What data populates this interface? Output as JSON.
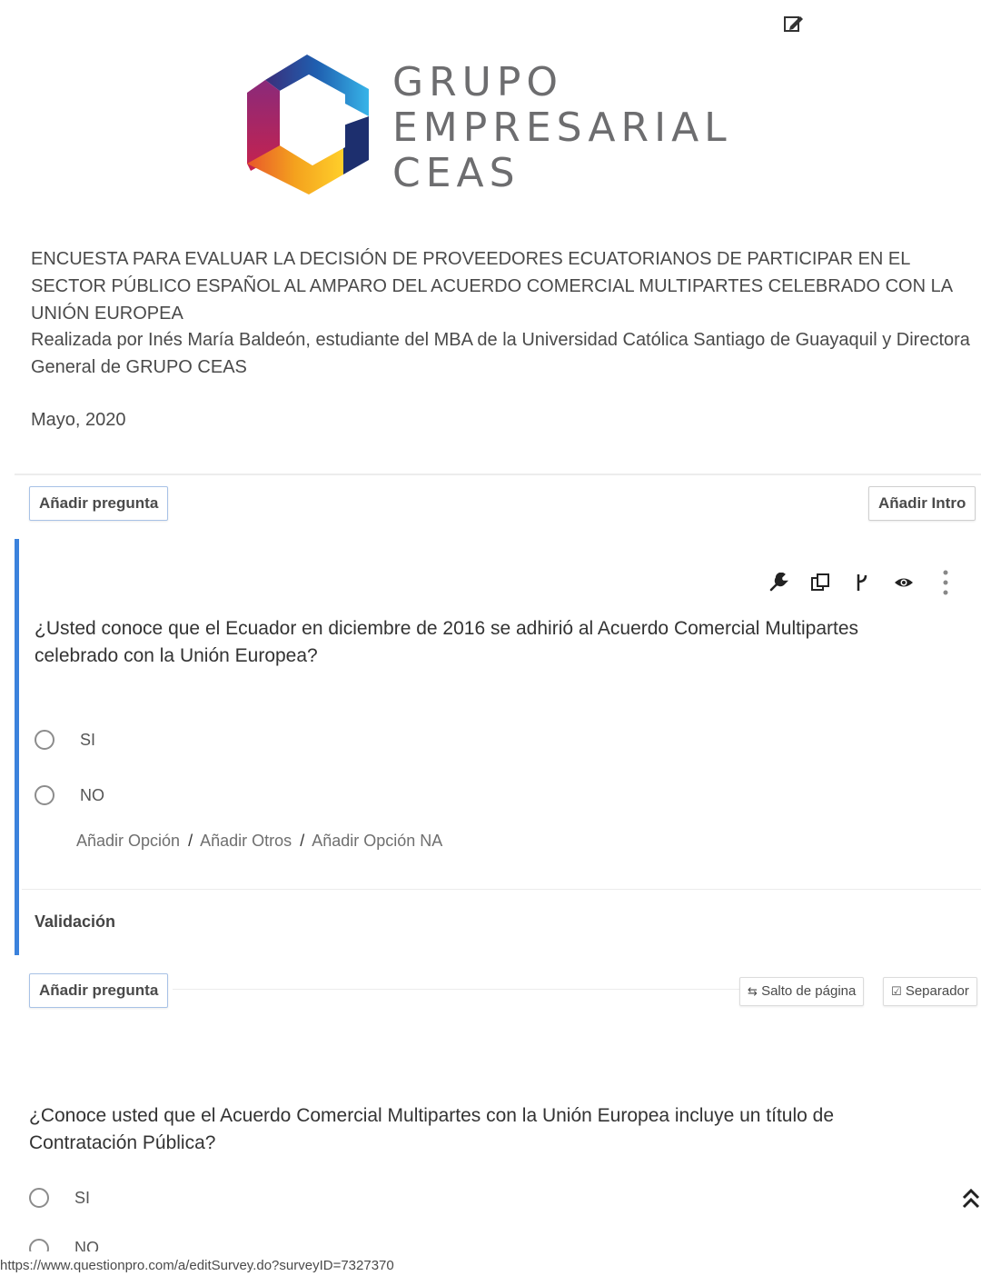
{
  "logo": {
    "line1": "GRUPO",
    "line2": "EMPRESARIAL",
    "line3": "CEAS"
  },
  "intro": {
    "title": "ENCUESTA PARA EVALUAR LA DECISIÓN DE PROVEEDORES ECUATORIANOS DE PARTICIPAR EN EL SECTOR PÚBLICO ESPAÑOL AL AMPARO DEL ACUERDO COMERCIAL MULTIPARTES CELEBRADO CON LA UNIÓN EUROPEA",
    "author": "Realizada por Inés María Baldeón, estudiante del MBA de la Universidad Católica Santiago de Guayaquil y Directora General de GRUPO CEAS",
    "date": "Mayo, 2020"
  },
  "toolbar_top": {
    "add_question": "Añadir pregunta",
    "add_intro": "Añadir Intro"
  },
  "question1": {
    "text": "¿Usted conoce que el Ecuador en diciembre de 2016 se adhirió al Acuerdo Comercial Multipartes celebrado con la Unión Europea?",
    "options": [
      "SI",
      "NO"
    ],
    "add_option": "Añadir Opción",
    "add_other": "Añadir Otros",
    "add_na": "Añadir Opción NA",
    "separator": "/",
    "validation": "Validación",
    "tools": [
      "wrench-icon",
      "copy-icon",
      "branch-icon",
      "eye-icon",
      "more-vertical-icon"
    ]
  },
  "toolbar_bottom": {
    "add_question": "Añadir pregunta",
    "page_break": "Salto de página",
    "separator": "Separador"
  },
  "question2": {
    "text": "¿Conoce usted que el Acuerdo Comercial Multipartes con la Unión Europea incluye un título de Contratación Pública?",
    "options": [
      "SI",
      "NO"
    ]
  },
  "status_url": "https://www.questionpro.com/a/editSurvey.do?surveyID=7327370",
  "colors": {
    "accent": "#3b82dc",
    "button_border": "#a8c2e6"
  }
}
